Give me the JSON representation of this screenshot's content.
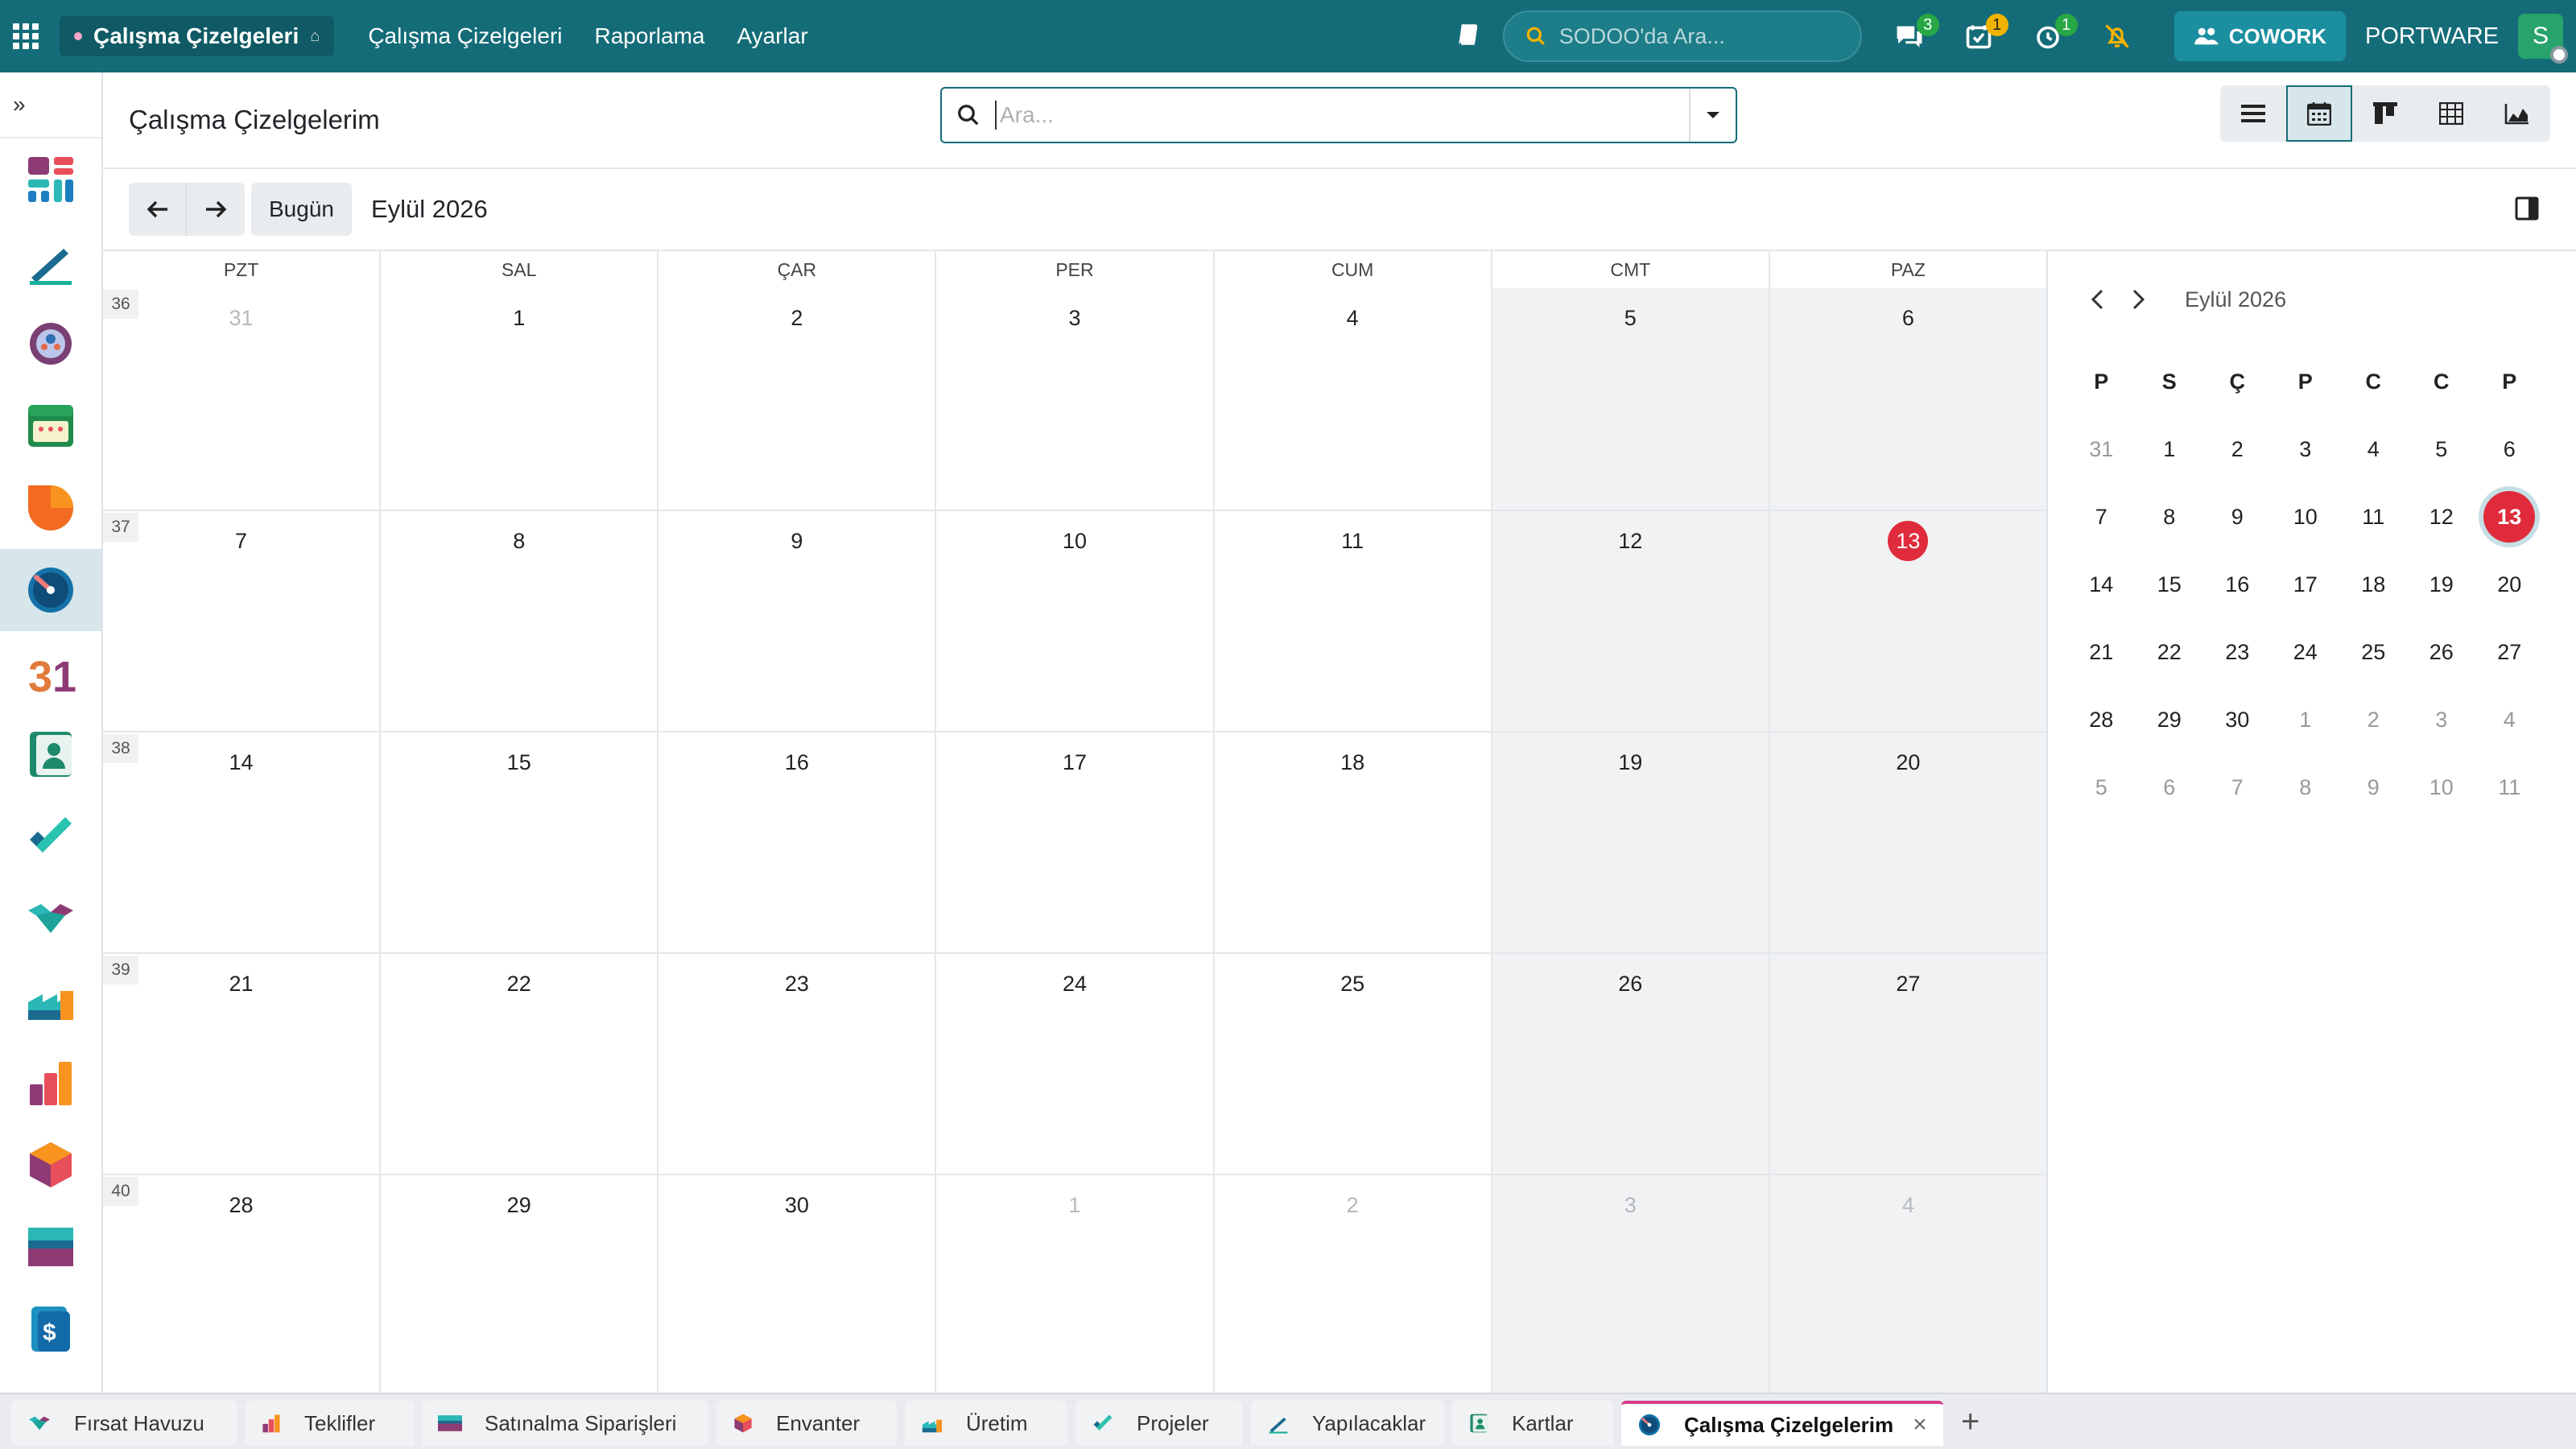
{
  "topbar": {
    "app_name": "Çalışma Çizelgeleri",
    "menu": [
      "Çalışma Çizelgeleri",
      "Raporlama",
      "Ayarlar"
    ],
    "search_placeholder": "SODOO'da Ara...",
    "badges": {
      "messages": "3",
      "activities": "1",
      "timer": "1"
    },
    "cowork_label": "COWORK",
    "company": "PORTWARE",
    "avatar_letter": "S"
  },
  "page": {
    "title": "Çalışma Çizelgelerim",
    "search_placeholder": "Ara...",
    "today_label": "Bugün",
    "range_label": "Eylül 2026"
  },
  "calendar": {
    "weekdays": [
      "PZT",
      "SAL",
      "ÇAR",
      "PER",
      "CUM",
      "CMT",
      "PAZ"
    ],
    "weeks": [
      {
        "num": "36",
        "days": [
          {
            "d": "31",
            "o": true
          },
          {
            "d": "1"
          },
          {
            "d": "2"
          },
          {
            "d": "3"
          },
          {
            "d": "4"
          },
          {
            "d": "5"
          },
          {
            "d": "6"
          }
        ]
      },
      {
        "num": "37",
        "days": [
          {
            "d": "7"
          },
          {
            "d": "8"
          },
          {
            "d": "9"
          },
          {
            "d": "10"
          },
          {
            "d": "11"
          },
          {
            "d": "12"
          },
          {
            "d": "13",
            "t": true
          }
        ]
      },
      {
        "num": "38",
        "days": [
          {
            "d": "14"
          },
          {
            "d": "15"
          },
          {
            "d": "16"
          },
          {
            "d": "17"
          },
          {
            "d": "18"
          },
          {
            "d": "19"
          },
          {
            "d": "20"
          }
        ]
      },
      {
        "num": "39",
        "days": [
          {
            "d": "21"
          },
          {
            "d": "22"
          },
          {
            "d": "23"
          },
          {
            "d": "24"
          },
          {
            "d": "25"
          },
          {
            "d": "26"
          },
          {
            "d": "27"
          }
        ]
      },
      {
        "num": "40",
        "days": [
          {
            "d": "28"
          },
          {
            "d": "29"
          },
          {
            "d": "30"
          },
          {
            "d": "1",
            "o": true
          },
          {
            "d": "2",
            "o": true
          },
          {
            "d": "3",
            "o": true
          },
          {
            "d": "4",
            "o": true
          }
        ]
      }
    ]
  },
  "mini_calendar": {
    "title": "Eylül 2026",
    "weekdays": [
      "P",
      "S",
      "Ç",
      "P",
      "C",
      "C",
      "P"
    ],
    "rows": [
      [
        {
          "d": "31",
          "o": true
        },
        {
          "d": "1"
        },
        {
          "d": "2"
        },
        {
          "d": "3"
        },
        {
          "d": "4"
        },
        {
          "d": "5"
        },
        {
          "d": "6"
        }
      ],
      [
        {
          "d": "7"
        },
        {
          "d": "8"
        },
        {
          "d": "9"
        },
        {
          "d": "10"
        },
        {
          "d": "11"
        },
        {
          "d": "12"
        },
        {
          "d": "13",
          "t": true
        }
      ],
      [
        {
          "d": "14"
        },
        {
          "d": "15"
        },
        {
          "d": "16"
        },
        {
          "d": "17"
        },
        {
          "d": "18"
        },
        {
          "d": "19"
        },
        {
          "d": "20"
        }
      ],
      [
        {
          "d": "21"
        },
        {
          "d": "22"
        },
        {
          "d": "23"
        },
        {
          "d": "24"
        },
        {
          "d": "25"
        },
        {
          "d": "26"
        },
        {
          "d": "27"
        }
      ],
      [
        {
          "d": "28"
        },
        {
          "d": "29"
        },
        {
          "d": "30"
        },
        {
          "d": "1",
          "o": true
        },
        {
          "d": "2",
          "o": true
        },
        {
          "d": "3",
          "o": true
        },
        {
          "d": "4",
          "o": true
        }
      ],
      [
        {
          "d": "5",
          "o": true
        },
        {
          "d": "6",
          "o": true
        },
        {
          "d": "7",
          "o": true
        },
        {
          "d": "8",
          "o": true
        },
        {
          "d": "9",
          "o": true
        },
        {
          "d": "10",
          "o": true
        },
        {
          "d": "11",
          "o": true
        }
      ]
    ]
  },
  "bottom_tabs": [
    {
      "label": "Fırsat Havuzu",
      "icon": "crm-icon"
    },
    {
      "label": "Teklifler",
      "icon": "sales-icon"
    },
    {
      "label": "Satınalma Siparişleri",
      "icon": "purchase-icon"
    },
    {
      "label": "Envanter",
      "icon": "inventory-icon"
    },
    {
      "label": "Üretim",
      "icon": "manufacturing-icon"
    },
    {
      "label": "Projeler",
      "icon": "project-icon"
    },
    {
      "label": "Yapılacaklar",
      "icon": "todo-icon"
    },
    {
      "label": "Kartlar",
      "icon": "contacts-icon"
    },
    {
      "label": "Çalışma Çizelgelerim",
      "icon": "timesheet-icon",
      "active": true
    }
  ],
  "sidebar_apps": [
    "dashboard-icon",
    "todo-icon",
    "hr-icon",
    "planning-icon",
    "discuss-icon",
    "timesheet-icon",
    "calendar-icon",
    "contacts-icon",
    "project-icon",
    "crm-icon",
    "manufacturing-icon",
    "sales-icon",
    "inventory-icon",
    "purchase-icon",
    "invoicing-icon"
  ],
  "colors": {
    "brand": "#146c78",
    "today": "#e02b3c",
    "accent": "#d43b8b"
  }
}
